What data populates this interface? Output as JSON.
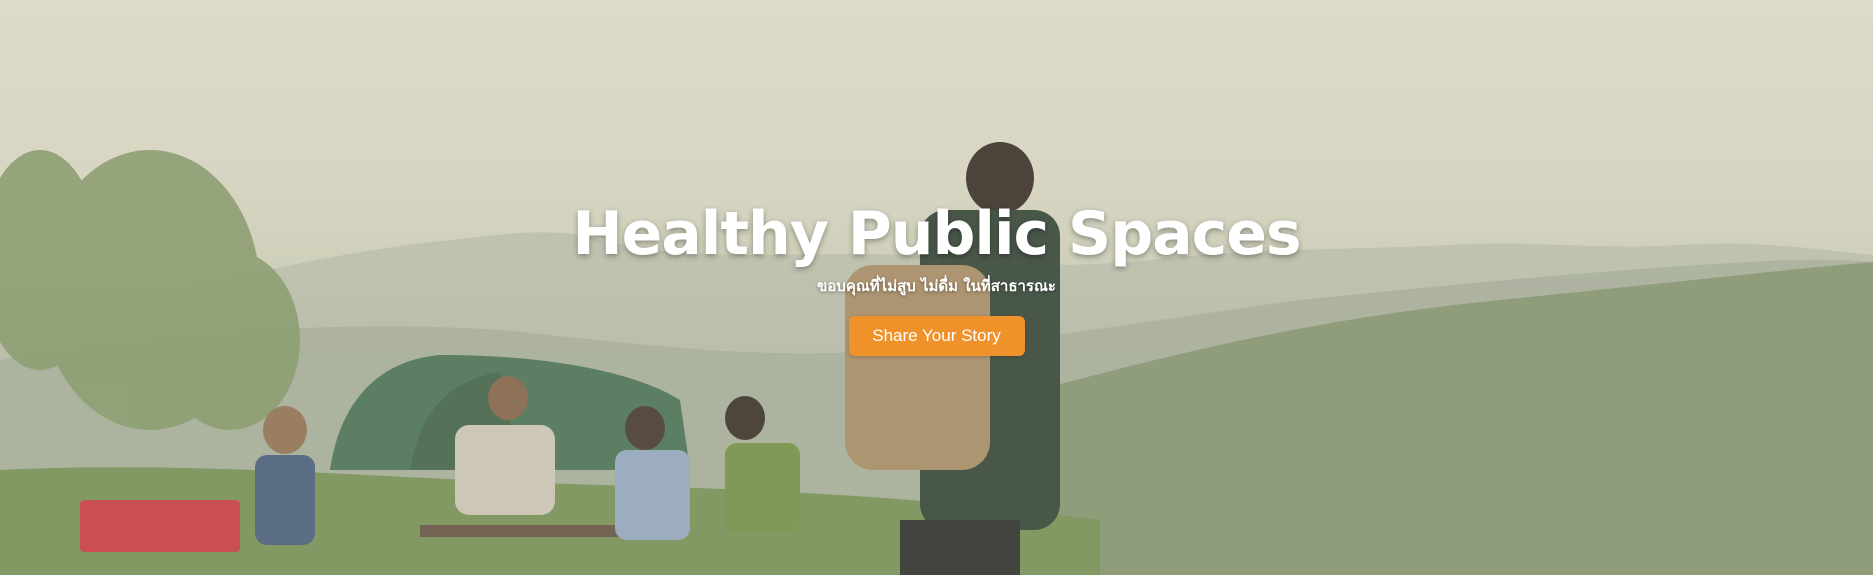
{
  "hero": {
    "title": "Healthy Public Spaces",
    "subtitle": "ขอบคุณที่ไม่สูบ ไม่ดื่ม ในที่สาธารณะ",
    "cta_label": "Share Your Story"
  },
  "colors": {
    "cta_background": "#f0922a",
    "text": "#ffffff",
    "sky": "#dcd9c8",
    "hills": "#8a9a84"
  }
}
